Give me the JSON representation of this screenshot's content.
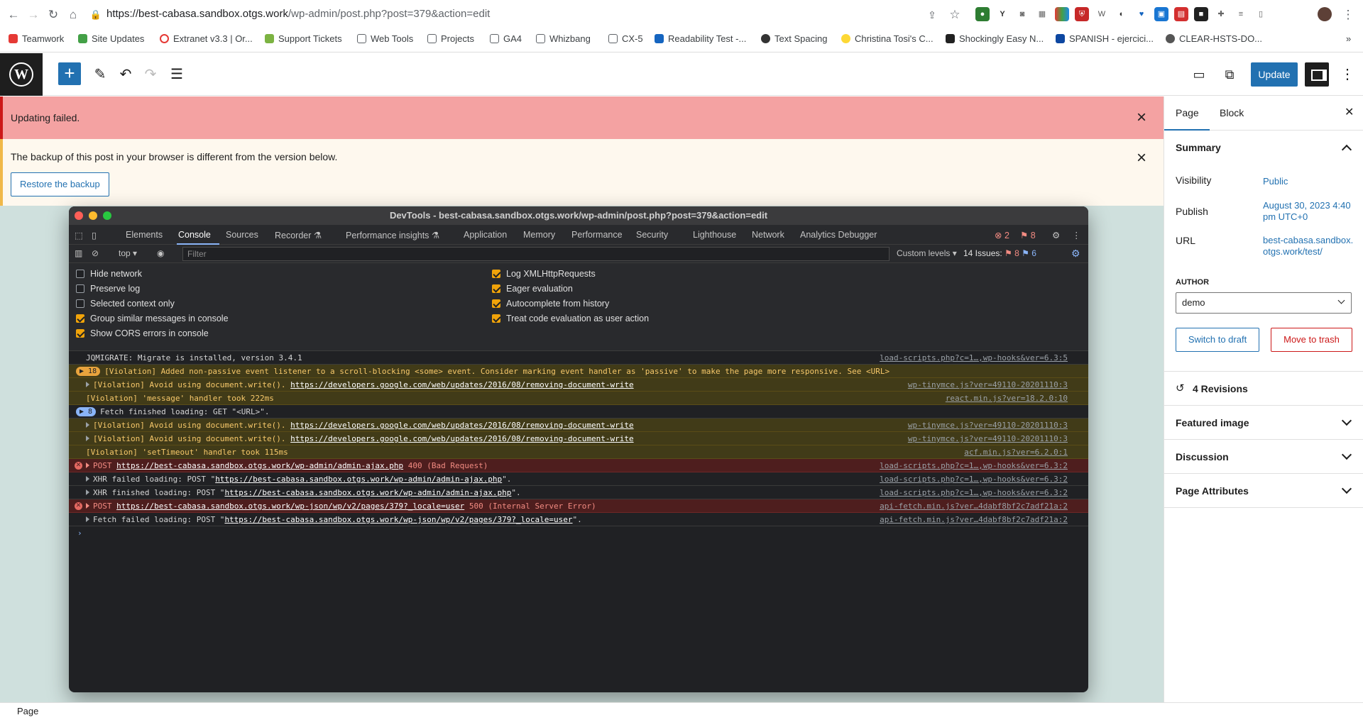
{
  "browser": {
    "url_domain": "https://best-cabasa.sandbox.otgs.work",
    "url_path": "/wp-admin/post.php?post=379&action=edit",
    "bookmarks": [
      "Teamwork",
      "Site Updates",
      "Extranet v3.3 | Or...",
      "Support Tickets",
      "Web Tools",
      "Projects",
      "GA4",
      "Whizbang",
      "CX-5",
      "Readability Test -...",
      "Text Spacing",
      "Christina Tosi's C...",
      "Shockingly Easy N...",
      "SPANISH - ejercici...",
      "CLEAR-HSTS-DO..."
    ],
    "more": "»"
  },
  "wp": {
    "update_label": "Update"
  },
  "notices": {
    "error": "Updating failed.",
    "backup": "The backup of this post in your browser is different from the version below.",
    "restore": "Restore the backup"
  },
  "devtools": {
    "title": "DevTools - best-cabasa.sandbox.otgs.work/wp-admin/post.php?post=379&action=edit",
    "tabs": [
      "Elements",
      "Console",
      "Sources",
      "Recorder ⚗",
      "Performance insights ⚗",
      "Application",
      "Memory",
      "Performance",
      "Security",
      "Lighthouse",
      "Network",
      "Analytics Debugger"
    ],
    "err_count": "2",
    "warn_count": "8",
    "context": "top",
    "filter_placeholder": "Filter",
    "levels": "Custom levels ▾",
    "issues_label": "14 Issues:",
    "issues_warn": "8",
    "issues_info": "6",
    "options_left": [
      {
        "label": "Hide network",
        "checked": false
      },
      {
        "label": "Preserve log",
        "checked": false
      },
      {
        "label": "Selected context only",
        "checked": false
      },
      {
        "label": "Group similar messages in console",
        "checked": true
      },
      {
        "label": "Show CORS errors in console",
        "checked": true
      }
    ],
    "options_right": [
      {
        "label": "Log XMLHttpRequests",
        "checked": true
      },
      {
        "label": "Eager evaluation",
        "checked": true
      },
      {
        "label": "Autocomplete from history",
        "checked": true
      },
      {
        "label": "Treat code evaluation as user action",
        "checked": true
      }
    ],
    "console": {
      "l1": {
        "text": "JQMIGRATE: Migrate is installed, version 3.4.1",
        "src": "load-scripts.php?c=1…,wp-hooks&ver=6.3:5"
      },
      "l2": {
        "count": "18",
        "text": "[Violation] Added non-passive event listener to a scroll-blocking <some> event. Consider marking event handler as 'passive' to make the page more responsive. See <URL>"
      },
      "l3": {
        "text": "[Violation] Avoid using document.write(). ",
        "link": "https://developers.google.com/web/updates/2016/08/removing-document-write",
        "src": "wp-tinymce.js?ver=49110-20201110:3"
      },
      "l4": {
        "text": "[Violation] 'message' handler took 222ms",
        "src": "react.min.js?ver=18.2.0:10"
      },
      "l5": {
        "count": "8",
        "text": "Fetch finished loading: GET \"<URL>\"."
      },
      "l6": {
        "text": "[Violation] Avoid using document.write(). ",
        "link": "https://developers.google.com/web/updates/2016/08/removing-document-write",
        "src": "wp-tinymce.js?ver=49110-20201110:3"
      },
      "l7": {
        "text": "[Violation] Avoid using document.write(). ",
        "link": "https://developers.google.com/web/updates/2016/08/removing-document-write",
        "src": "wp-tinymce.js?ver=49110-20201110:3"
      },
      "l8": {
        "text": "[Violation] 'setTimeout' handler took 115ms",
        "src": "acf.min.js?ver=6.2.0:1"
      },
      "l9": {
        "pre": "POST ",
        "link": "https://best-cabasa.sandbox.otgs.work/wp-admin/admin-ajax.php",
        "post": " 400 (Bad Request)",
        "src": "load-scripts.php?c=1…,wp-hooks&ver=6.3:2"
      },
      "l10": {
        "pre": "XHR failed loading: POST \"",
        "link": "https://best-cabasa.sandbox.otgs.work/wp-admin/admin-ajax.php",
        "post": "\".",
        "src": "load-scripts.php?c=1…,wp-hooks&ver=6.3:2"
      },
      "l11": {
        "pre": "XHR finished loading: POST \"",
        "link": "https://best-cabasa.sandbox.otgs.work/wp-admin/admin-ajax.php",
        "post": "\".",
        "src": "load-scripts.php?c=1…,wp-hooks&ver=6.3:2"
      },
      "l12": {
        "pre": "POST ",
        "link": "https://best-cabasa.sandbox.otgs.work/wp-json/wp/v2/pages/379?_locale=user",
        "post": " 500 (Internal Server Error)",
        "src": "api-fetch.min.js?ver…4dabf8bf2c7adf21a:2"
      },
      "l13": {
        "pre": "Fetch failed loading: POST \"",
        "link": "https://best-cabasa.sandbox.otgs.work/wp-json/wp/v2/pages/379?_locale=user",
        "post": "\".",
        "src": "api-fetch.min.js?ver…4dabf8bf2c7adf21a:2"
      },
      "prompt": "›"
    }
  },
  "sidebar": {
    "tab_page": "Page",
    "tab_block": "Block",
    "summary": "Summary",
    "visibility_label": "Visibility",
    "visibility_value": "Public",
    "publish_label": "Publish",
    "publish_value": "August 30, 2023 4:40 pm UTC+0",
    "url_label": "URL",
    "url_value": "best-cabasa.sandbox.otgs.work/test/",
    "author_label": "AUTHOR",
    "author_value": "demo",
    "switch_draft": "Switch to draft",
    "move_trash": "Move to trash",
    "revisions": "4 Revisions",
    "featured_image": "Featured image",
    "discussion": "Discussion",
    "page_attributes": "Page Attributes"
  },
  "statusbar": {
    "text": "Page"
  }
}
